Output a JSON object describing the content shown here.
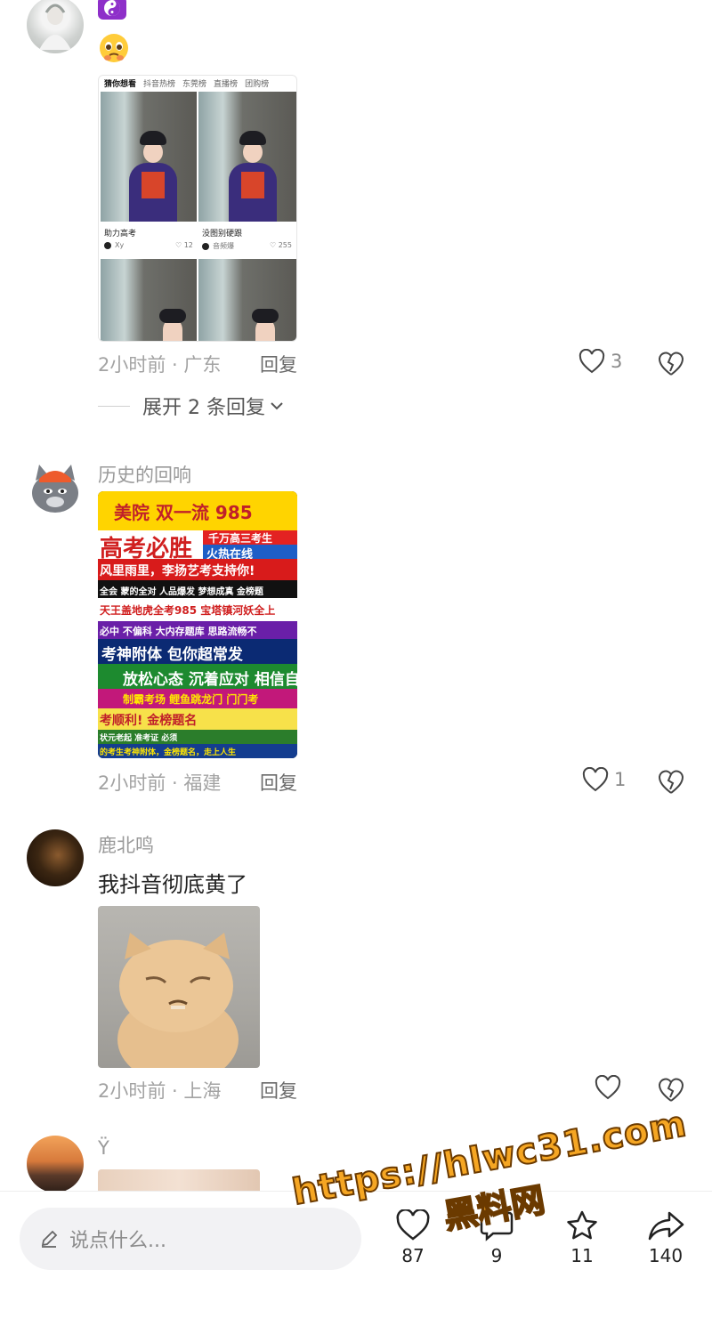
{
  "comments": [
    {
      "username": "",
      "text_emoji": "☯ 🥹",
      "time_location": "2小时前 · 广东",
      "reply_label": "回复",
      "likes": "3",
      "expand_label": "展开 2 条回复",
      "embedded_screenshot": {
        "tabs": [
          "猜你想看",
          "抖音热榜",
          "东莞榜",
          "直播榜",
          "团购榜"
        ],
        "cards": [
          {
            "title": "助力高考",
            "author": "Xy",
            "likes": "12"
          },
          {
            "title": "没图别硬跟",
            "author": "音频爆",
            "likes": "255"
          }
        ]
      }
    },
    {
      "username": "历史的回响",
      "time_location": "2小时前 · 福建",
      "reply_label": "回复",
      "likes": "1",
      "poster_lines": [
        "美院 双一流 985",
        "高考必胜",
        "千万高三考生",
        "火热在线",
        "风里雨里，李扬艺考支持你!",
        "全会 蒙的全对 人品爆发 梦想成真 金榜题",
        "天王盖地虎全考985 宝塔镇河妖全上",
        "必中 不偏科 大内存题库 思路流畅不",
        "考神附体 包你超常发",
        "放松心态 沉着应对 相信自",
        "制霸考场 鲤鱼跳龙门 门门考",
        "考顺利! 金榜题名",
        "状元老起 准考证 必须",
        "的考生考神附体，金榜题名，走上人生"
      ]
    },
    {
      "username": "鹿北鸣",
      "text": "我抖音彻底黄了",
      "time_location": "2小时前 · 上海",
      "reply_label": "回复",
      "likes": ""
    },
    {
      "username": "Ÿ"
    }
  ],
  "bottom_bar": {
    "input_placeholder": "说点什么...",
    "like_count": "87",
    "comment_count": "9",
    "star_count": "11",
    "share_count": "140"
  },
  "watermark": {
    "line1": "https://hlwc31.com",
    "line2": "黑料网"
  },
  "colors": {
    "watermark_fill": "#f5a623",
    "watermark_stroke": "#6b3a00",
    "meta_gray": "#a3a3a3"
  }
}
